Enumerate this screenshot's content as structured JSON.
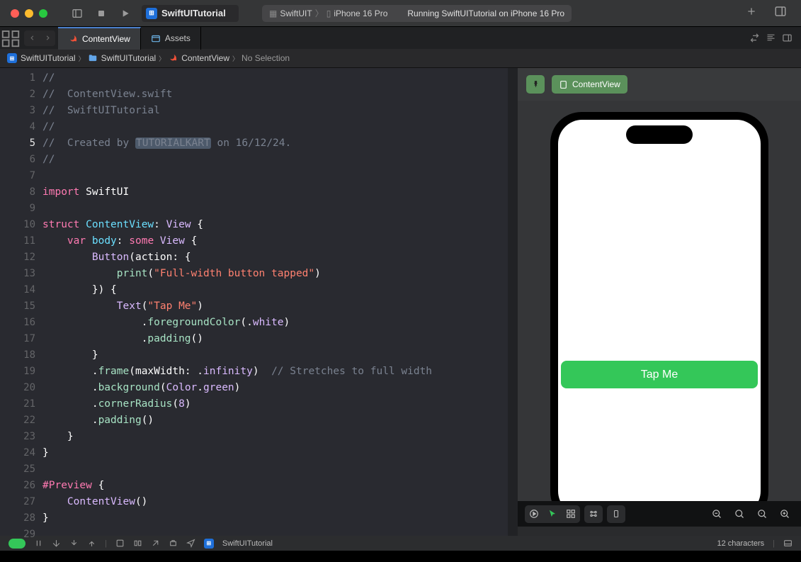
{
  "app": {
    "projectName": "SwiftUITutorial",
    "statusLeft": "SwiftUIT",
    "device": "iPhone 16 Pro",
    "statusText": "Running SwiftUITutorial on iPhone 16 Pro"
  },
  "tabs": [
    {
      "label": "ContentView",
      "icon": "swift"
    },
    {
      "label": "Assets",
      "icon": "assets"
    }
  ],
  "breadcrumbs": {
    "proj": "SwiftUITutorial",
    "folder": "SwiftUITutorial",
    "file": "ContentView",
    "sel": "No Selection"
  },
  "currentLine": 5,
  "code": {
    "lines": 29,
    "author": "TUTORIALKART",
    "date": "16/12/24",
    "file": "ContentView.swift",
    "project": "SwiftUITutorial",
    "import": "import",
    "swiftui": "SwiftUI",
    "struct": "struct",
    "contentview": "ContentView",
    "view": "View",
    "var": "var",
    "body": "body",
    "some": "some",
    "button": "Button",
    "action": "action",
    "print": "print",
    "str1": "\"Full-width button tapped\"",
    "text": "Text",
    "str2": "\"Tap Me\"",
    "fg": "foregroundColor",
    "white": "white",
    "padding": "padding",
    "frame": "frame",
    "maxw": "maxWidth",
    "inf": "infinity",
    "stretchComment": "// Stretches to full width",
    "bg": "background",
    "color": "Color",
    "green": "green",
    "cr": "cornerRadius",
    "crVal": "8",
    "preview": "#Preview",
    "created": "Created by",
    "on": "on"
  },
  "preview": {
    "title": "ContentView",
    "button": "Tap Me"
  },
  "footer": {
    "chars": "12 characters",
    "proj": "SwiftUITutorial"
  }
}
